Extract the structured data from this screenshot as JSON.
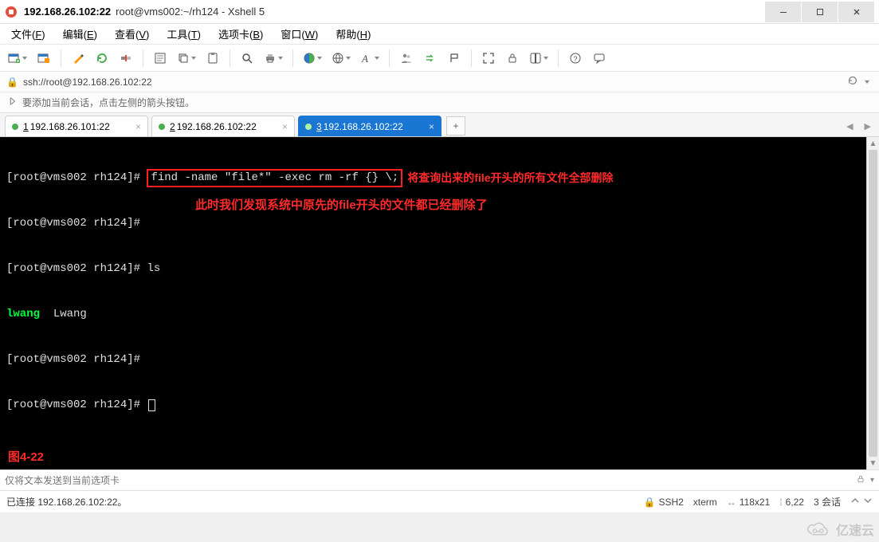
{
  "titlebar": {
    "title_bold": "192.168.26.102:22",
    "title_suffix": "root@vms002:~/rh124 - Xshell 5"
  },
  "menu": {
    "items": [
      {
        "pre": "文件(",
        "key": "F",
        "post": ")"
      },
      {
        "pre": "编辑(",
        "key": "E",
        "post": ")"
      },
      {
        "pre": "查看(",
        "key": "V",
        "post": ")"
      },
      {
        "pre": "工具(",
        "key": "T",
        "post": ")"
      },
      {
        "pre": "选项卡(",
        "key": "B",
        "post": ")"
      },
      {
        "pre": "窗口(",
        "key": "W",
        "post": ")"
      },
      {
        "pre": "帮助(",
        "key": "H",
        "post": ")"
      }
    ]
  },
  "addressbar": {
    "url": "ssh://root@192.168.26.102:22"
  },
  "tipbar": {
    "text": "要添加当前会话，点击左侧的箭头按钮。"
  },
  "tabs": {
    "tab1": {
      "num": "1",
      "label": "192.168.26.101:22"
    },
    "tab2": {
      "num": "2",
      "label": "192.168.26.102:22"
    },
    "tab3": {
      "num": "3",
      "label": "192.168.26.102:22"
    },
    "add": "+",
    "nav_left": "◀",
    "nav_right": "▶"
  },
  "terminal": {
    "lines": {
      "p1_prompt": "[root@vms002 rh124]# ",
      "p1_cmd": "find -name \"file*\" -exec rm -rf {} \\;",
      "p1_note": "将查询出来的file开头的所有文件全部删除",
      "p2_prompt": "[root@vms002 rh124]# ",
      "p3_prompt": "[root@vms002 rh124]# ",
      "p3_cmd": "ls",
      "p4_green": "lwang",
      "p4_rest": "  Lwang",
      "p5_prompt": "[root@vms002 rh124]# ",
      "p6_prompt": "[root@vms002 rh124]# "
    },
    "note2": "此时我们发现系统中原先的file开头的文件都已经删除了",
    "figure_label": "图4-22"
  },
  "bottom_input": {
    "placeholder": "仅将文本发送到当前选项卡"
  },
  "statusbar": {
    "conn": "已连接 192.168.26.102:22。",
    "ssh": "SSH2",
    "term": "xterm",
    "size": "118x21",
    "pos": "6,22",
    "sessions": "3 会话",
    "size_icon": "↔",
    "pos_icon": "⁞"
  },
  "watermark": {
    "text": "亿速云"
  },
  "icons": {
    "lock": "🔒"
  }
}
